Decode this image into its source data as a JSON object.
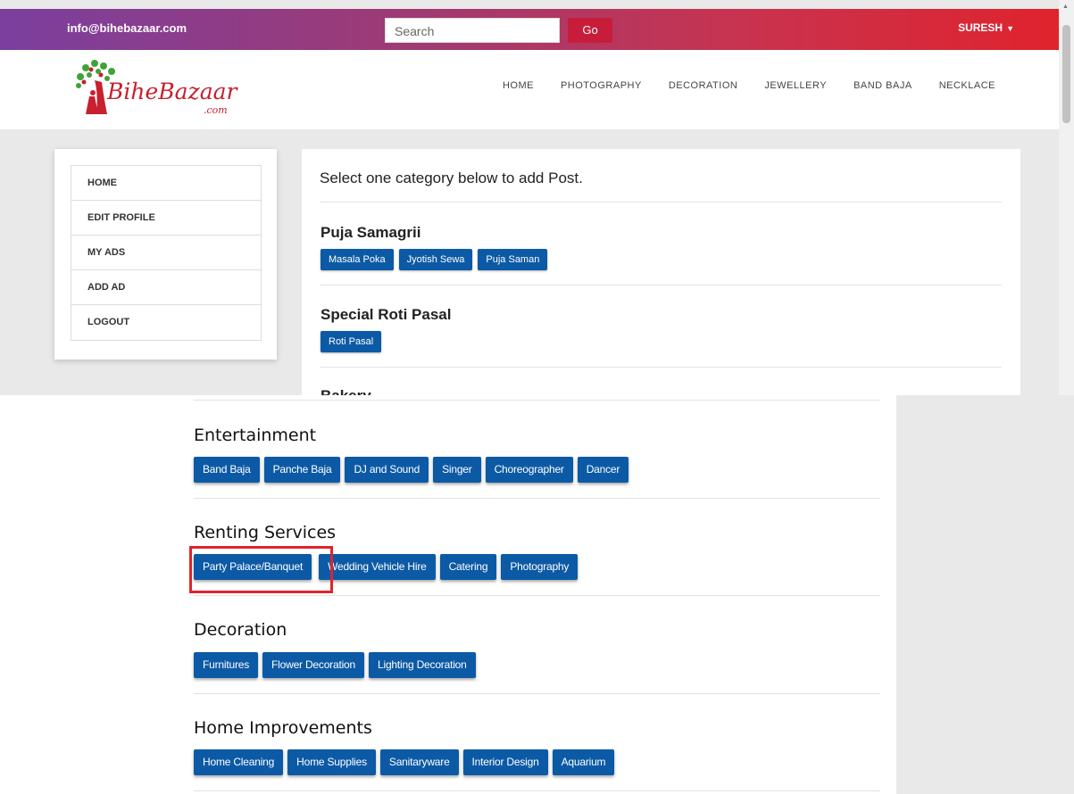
{
  "header": {
    "email": "info@bihebazaar.com",
    "search_placeholder": "Search",
    "go_label": "Go",
    "user_label": "SURESH",
    "colors": {
      "gradient_start": "#7b3f9e",
      "gradient_end": "#e0232d",
      "go_button": "#c81d3a"
    }
  },
  "logo": {
    "brand": "BiheBazaar",
    "suffix": ".com"
  },
  "nav": {
    "items": [
      "HOME",
      "PHOTOGRAPHY",
      "DECORATION",
      "JEWELLERY",
      "BAND BAJA",
      "NECKLACE"
    ]
  },
  "sidebar": {
    "items": [
      "HOME",
      "EDIT PROFILE",
      "MY ADS",
      "ADD AD",
      "LOGOUT"
    ]
  },
  "content": {
    "heading": "Select one category below to add Post.",
    "categories": [
      {
        "title": "Puja Samagrii",
        "buttons": [
          "Masala Poka",
          "Jyotish Sewa",
          "Puja Saman"
        ]
      },
      {
        "title": "Special Roti Pasal",
        "buttons": [
          "Roti Pasal"
        ]
      },
      {
        "title": "Bakery",
        "buttons": []
      }
    ]
  },
  "lower": {
    "categories": [
      {
        "title": "Entertainment",
        "buttons": [
          "Band Baja",
          "Panche Baja",
          "DJ and Sound",
          "Singer",
          "Choreographer",
          "Dancer"
        ]
      },
      {
        "title": "Renting Services",
        "buttons": [
          "Party Palace/Banquet",
          "Wedding Vehicle Hire",
          "Catering",
          "Photography"
        ]
      },
      {
        "title": "Decoration",
        "buttons": [
          "Furnitures",
          "Flower Decoration",
          "Lighting Decoration"
        ]
      },
      {
        "title": "Home Improvements",
        "buttons": [
          "Home Cleaning",
          "Home Supplies",
          "Sanitaryware",
          "Interior Design",
          "Aquarium"
        ]
      }
    ],
    "highlighted_button": "Party Palace/Banquet"
  },
  "colors": {
    "button": "#0c5aa5",
    "highlight": "#e0232d",
    "page_bg": "#e9e9e9"
  }
}
